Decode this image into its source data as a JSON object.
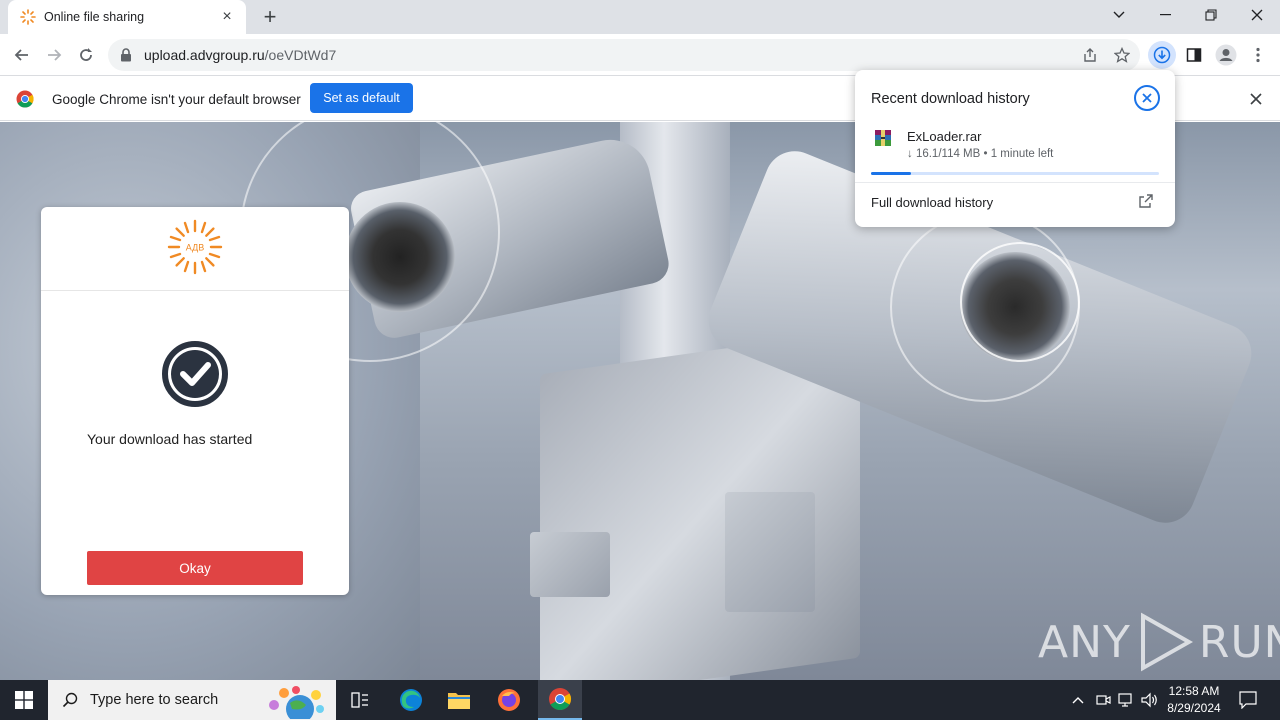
{
  "browser": {
    "tab_title": "Online file sharing",
    "url_host": "upload.advgroup.ru",
    "url_path": "/oeVDtWd7"
  },
  "infobar": {
    "message": "Google Chrome isn't your default browser",
    "button_label": "Set as default"
  },
  "card": {
    "logo_text": "АДВ",
    "message": "Your download has started",
    "okay_label": "Okay"
  },
  "downloads": {
    "title": "Recent download history",
    "file_name": "ExLoader.rar",
    "file_status": "↓ 16.1/114 MB • 1 minute left",
    "progress_fraction": 0.14,
    "full_history_label": "Full download history"
  },
  "watermark": {
    "left": "ANY",
    "right": "RUN"
  },
  "taskbar": {
    "search_placeholder": "Type here to search",
    "time": "12:58 AM",
    "date": "8/29/2024"
  },
  "colors": {
    "accent": "#1a73e8",
    "okay_button": "#e04444",
    "taskbar": "#20252e",
    "logo_orange": "#f08a24"
  }
}
